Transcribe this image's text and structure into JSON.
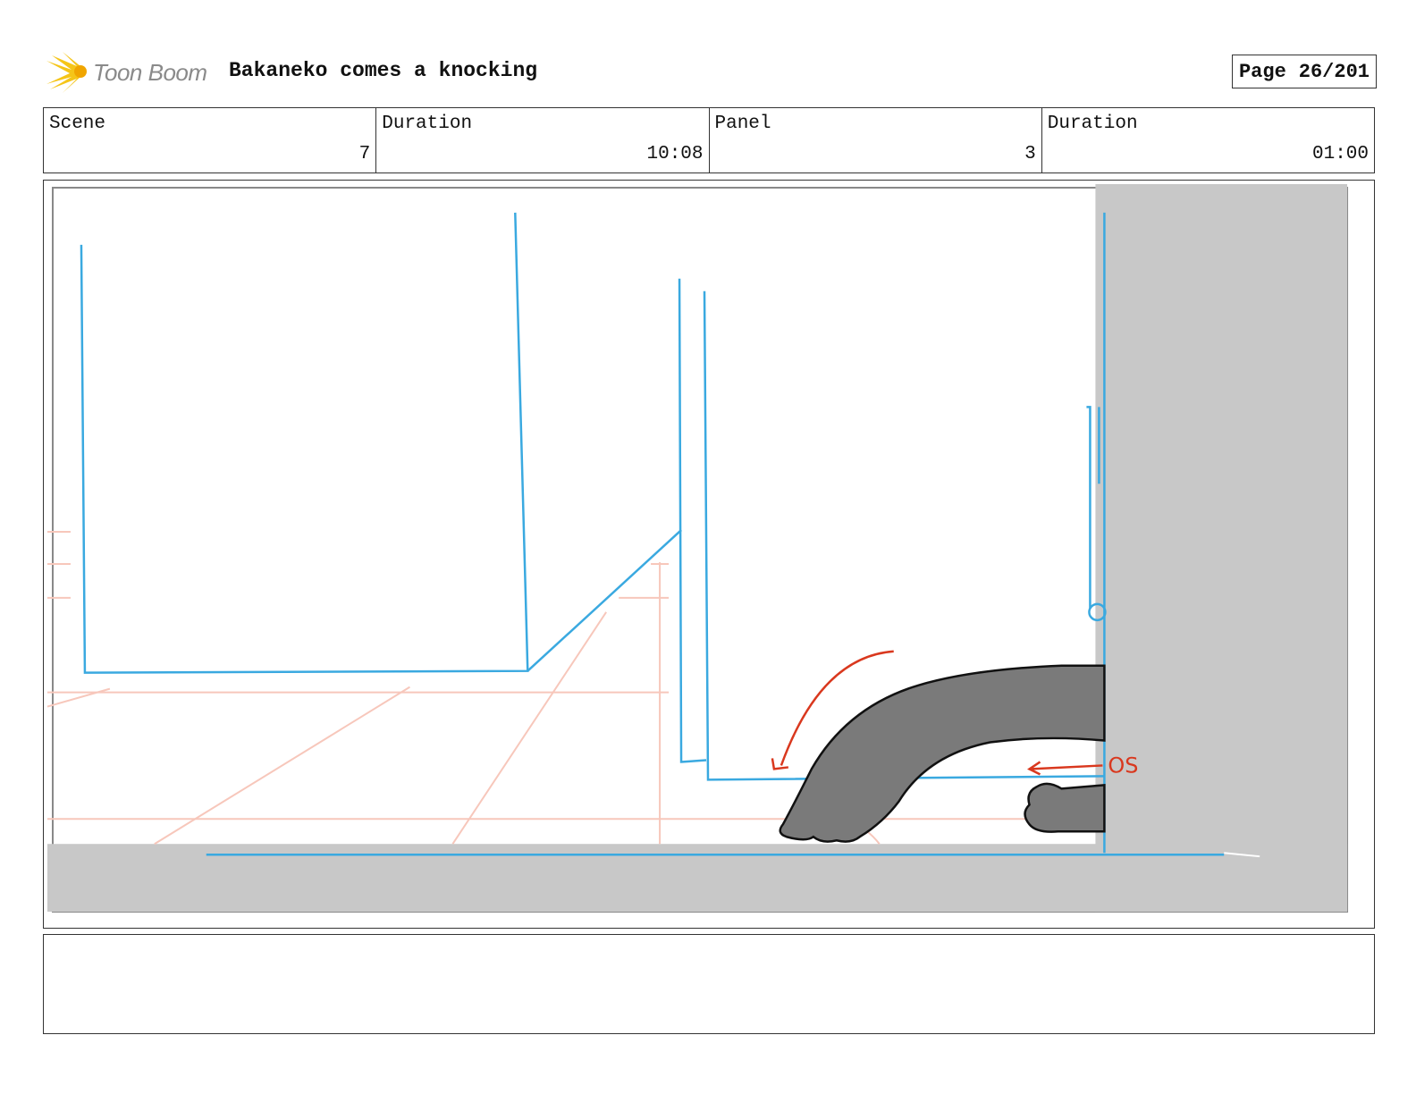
{
  "header": {
    "brand": "Toon Boom",
    "title": "Bakaneko comes a knocking",
    "page_label": "Page",
    "page_value": "26/201"
  },
  "info": {
    "scene_label": "Scene",
    "scene_value": "7",
    "scene_duration_label": "Duration",
    "scene_duration_value": "10:08",
    "panel_label": "Panel",
    "panel_value": "3",
    "panel_duration_label": "Duration",
    "panel_duration_value": "01:00"
  },
  "panel": {
    "annotation": "OS",
    "colors": {
      "layout_line": "#3aa9e0",
      "perspective_line": "#f7c7bb",
      "motion_arrow": "#d9381e",
      "wall_fill": "#c8c8c8",
      "arm_fill": "#7a7a7a"
    }
  },
  "notes": {
    "text": ""
  }
}
